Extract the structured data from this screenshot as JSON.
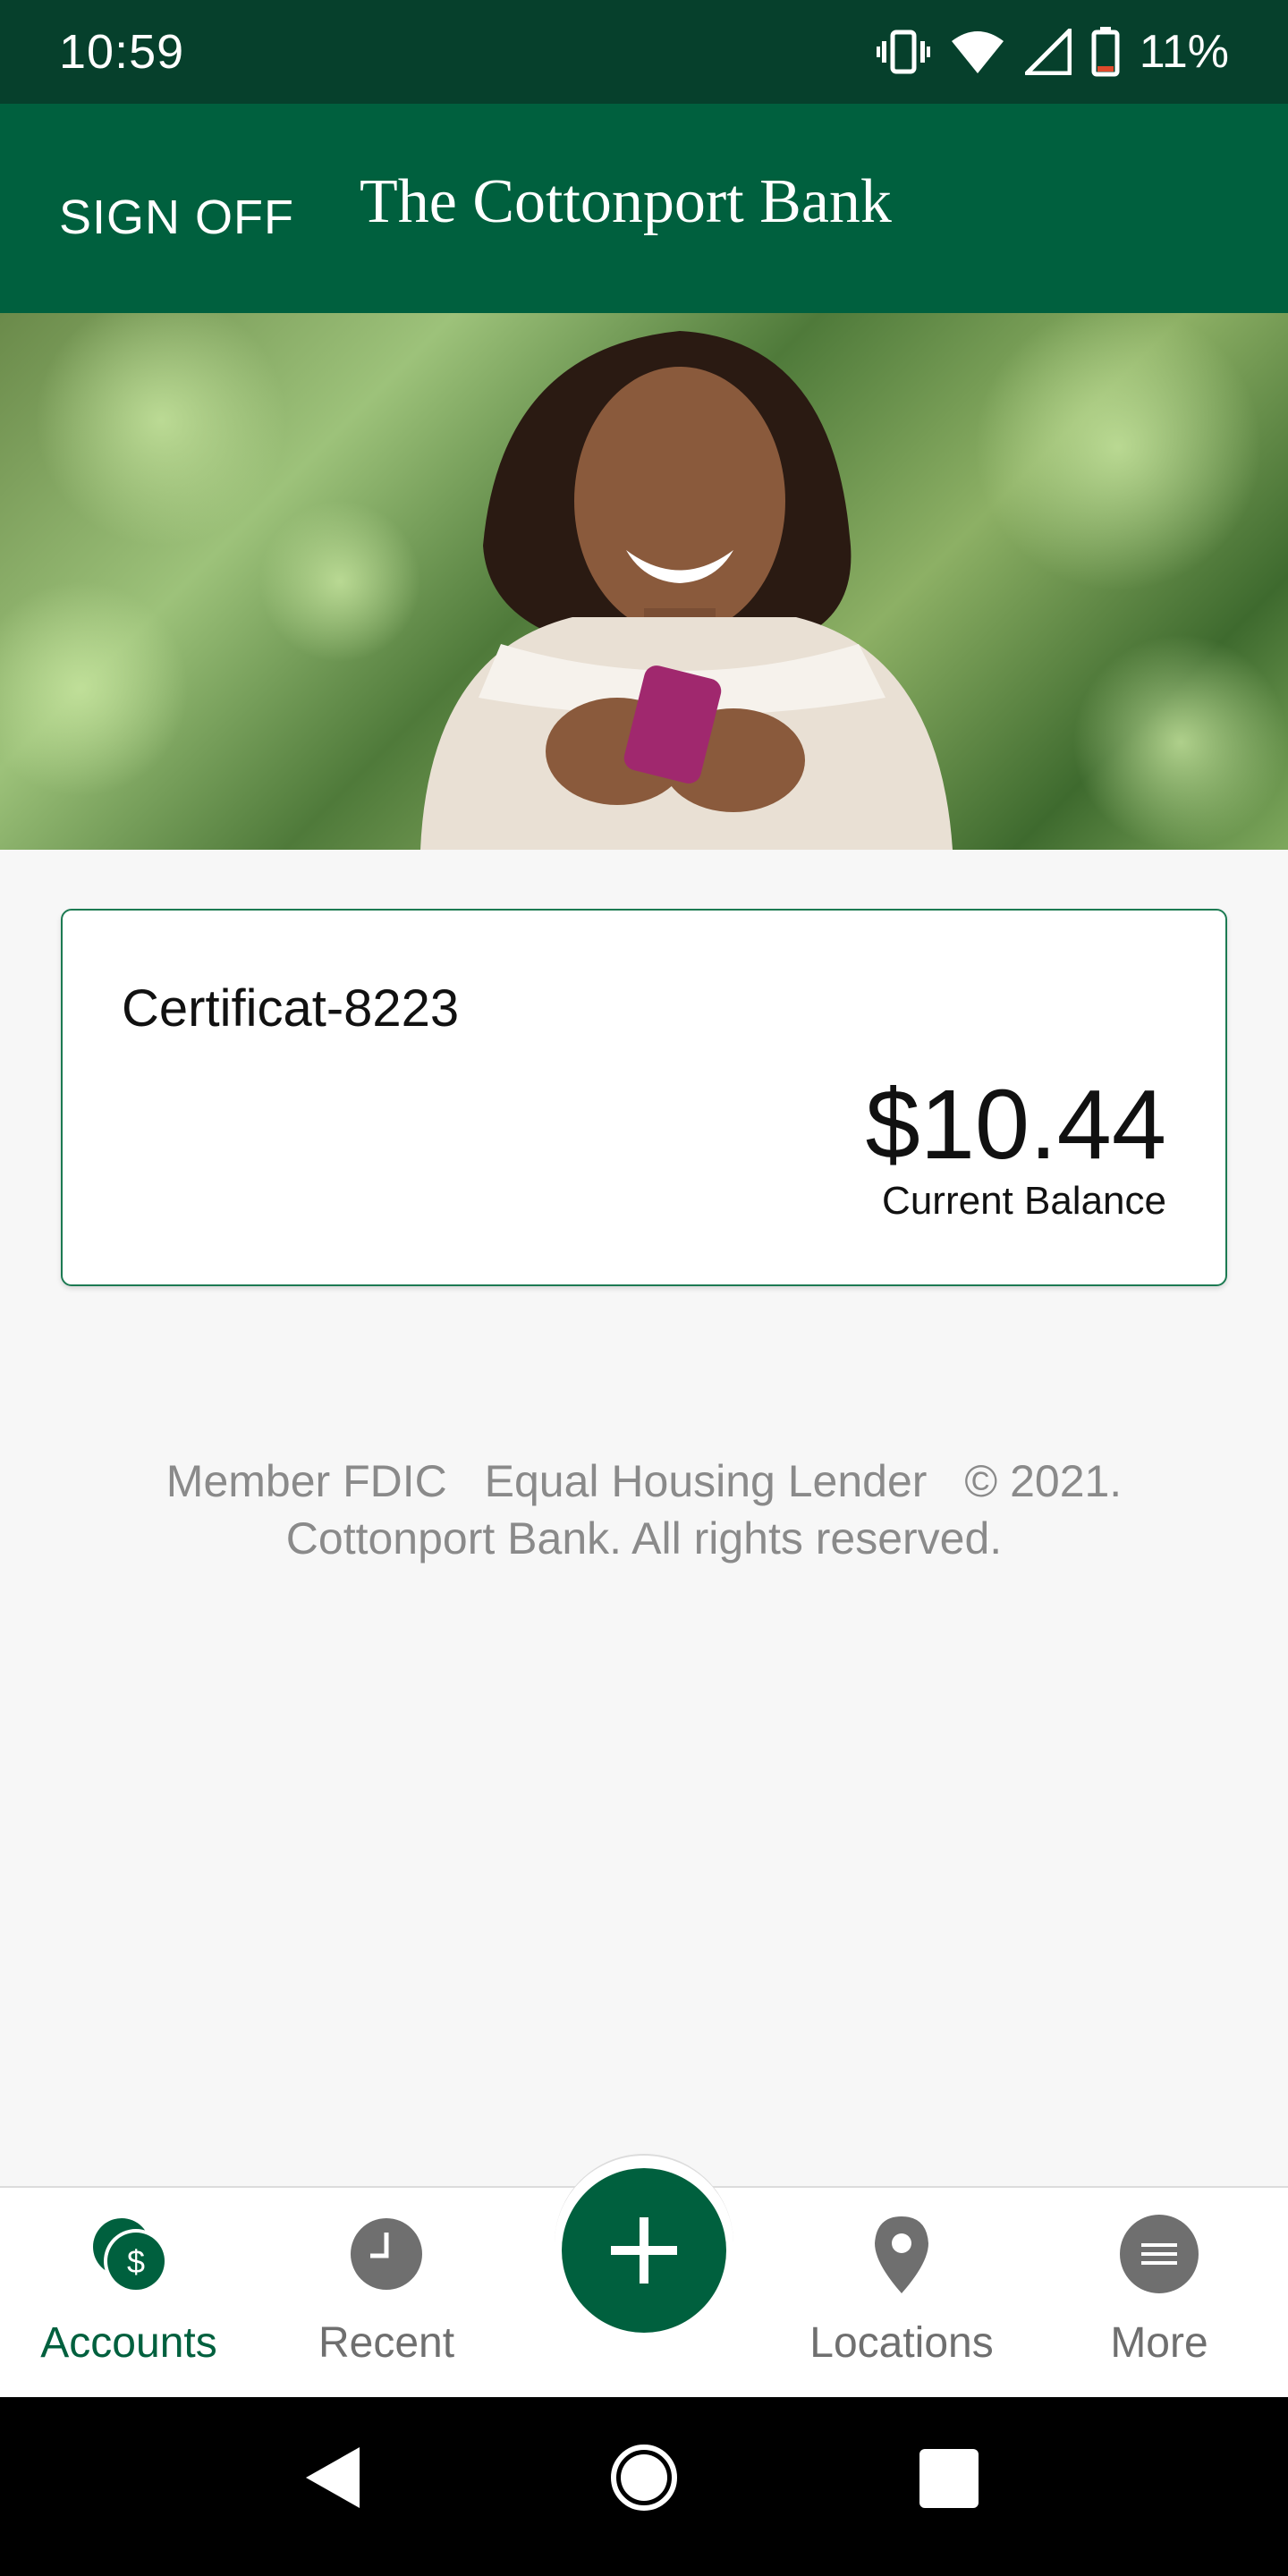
{
  "status_bar": {
    "time": "10:59",
    "battery": "11%",
    "icons": [
      "vibrate-icon",
      "wifi-icon",
      "signal-icon",
      "battery-icon"
    ]
  },
  "header": {
    "sign_off_label": "SIGN OFF",
    "bank_name": "The Cottonport Bank"
  },
  "account": {
    "name": "Certificat-8223",
    "balance": "$10.44",
    "balance_label": "Current Balance"
  },
  "footer": {
    "member": "Member FDIC",
    "lender": "Equal Housing Lender",
    "copyright": "© 2021.",
    "line2": "Cottonport Bank. All rights reserved."
  },
  "bottom_nav": {
    "items": [
      {
        "label": "Accounts",
        "icon": "accounts-icon",
        "active": true
      },
      {
        "label": "Recent",
        "icon": "clock-icon",
        "active": false
      },
      {
        "label": "",
        "icon": "plus-icon",
        "active": false
      },
      {
        "label": "Locations",
        "icon": "location-pin-icon",
        "active": false
      },
      {
        "label": "More",
        "icon": "menu-icon",
        "active": false
      }
    ]
  },
  "colors": {
    "status_bar": "#06402c",
    "brand_green": "#00603e",
    "nav_inactive": "#6f6f6f"
  }
}
